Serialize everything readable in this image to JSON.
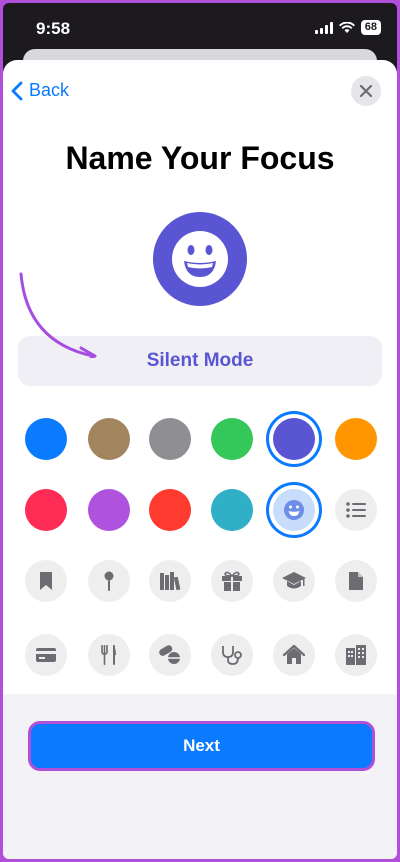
{
  "status_bar": {
    "time": "9:58",
    "battery": "68"
  },
  "nav": {
    "back_label": "Back"
  },
  "title": "Name Your Focus",
  "focus_name": {
    "value": "Silent Mode"
  },
  "colors": [
    {
      "name": "blue",
      "hex": "#0a7aff",
      "selected": false
    },
    {
      "name": "brown",
      "hex": "#a2845e",
      "selected": false
    },
    {
      "name": "gray",
      "hex": "#8e8e93",
      "selected": false
    },
    {
      "name": "green",
      "hex": "#34c759",
      "selected": false
    },
    {
      "name": "indigo",
      "hex": "#5a55d2",
      "selected": true
    },
    {
      "name": "orange",
      "hex": "#ff9500",
      "selected": false
    },
    {
      "name": "pink",
      "hex": "#ff2d55",
      "selected": false
    },
    {
      "name": "purple",
      "hex": "#af52de",
      "selected": false
    },
    {
      "name": "red",
      "hex": "#ff3b30",
      "selected": false
    },
    {
      "name": "teal",
      "hex": "#30b0c7",
      "selected": false
    }
  ],
  "symbols": [
    "smiley-icon",
    "list-icon",
    "bookmark-icon",
    "pin-icon",
    "books-icon",
    "gift-icon",
    "graduation-cap-icon",
    "document-icon",
    "credit-card-icon",
    "fork-knife-icon",
    "pills-icon",
    "stethoscope-icon",
    "house-icon",
    "building-icon"
  ],
  "selected_symbol": "smiley-icon",
  "accent_color": "#0a7aff",
  "focus_color": "#5a55d2",
  "next_button": {
    "label": "Next"
  }
}
